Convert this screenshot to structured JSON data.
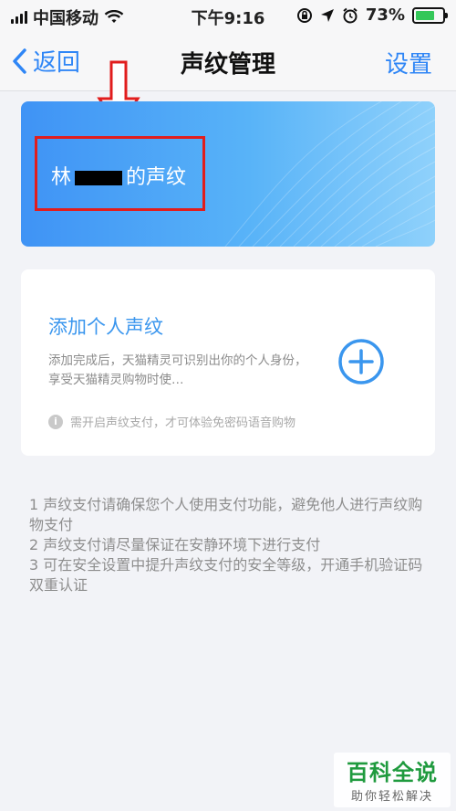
{
  "status_bar": {
    "carrier": "中国移动",
    "time": "下午9:16",
    "battery_percent": "73%",
    "battery_level": 0.73,
    "icons": [
      "signal-icon",
      "wifi-icon",
      "rotation-lock-icon",
      "location-icon",
      "alarm-icon",
      "battery-icon"
    ]
  },
  "nav": {
    "back_label": "返回",
    "title": "声纹管理",
    "settings_label": "设置"
  },
  "voice_card": {
    "name_suffix": "的声纹",
    "name_prefix_visible": "林"
  },
  "add_card": {
    "title": "添加个人声纹",
    "description": "添加完成后，天猫精灵可识别出你的个人身份，享受天猫精灵购物时使…",
    "hint": "需开启声纹支付，才可体验免密码语音购物"
  },
  "notes": [
    "1 声纹支付请确保您个人使用支付功能，避免他人进行声纹购物支付",
    "2 声纹支付请尽量保证在安静环境下进行支付",
    "3 可在安全设置中提升声纹支付的安全等级，开通手机验证码双重认证"
  ],
  "watermark": {
    "main": "百科全说",
    "sub": "助你轻松解决"
  },
  "colors": {
    "accent_blue": "#2f86f6",
    "annotation_red": "#e11d1d",
    "card_gradient_start": "#3f93f5",
    "watermark_green": "#1f9a3e"
  }
}
